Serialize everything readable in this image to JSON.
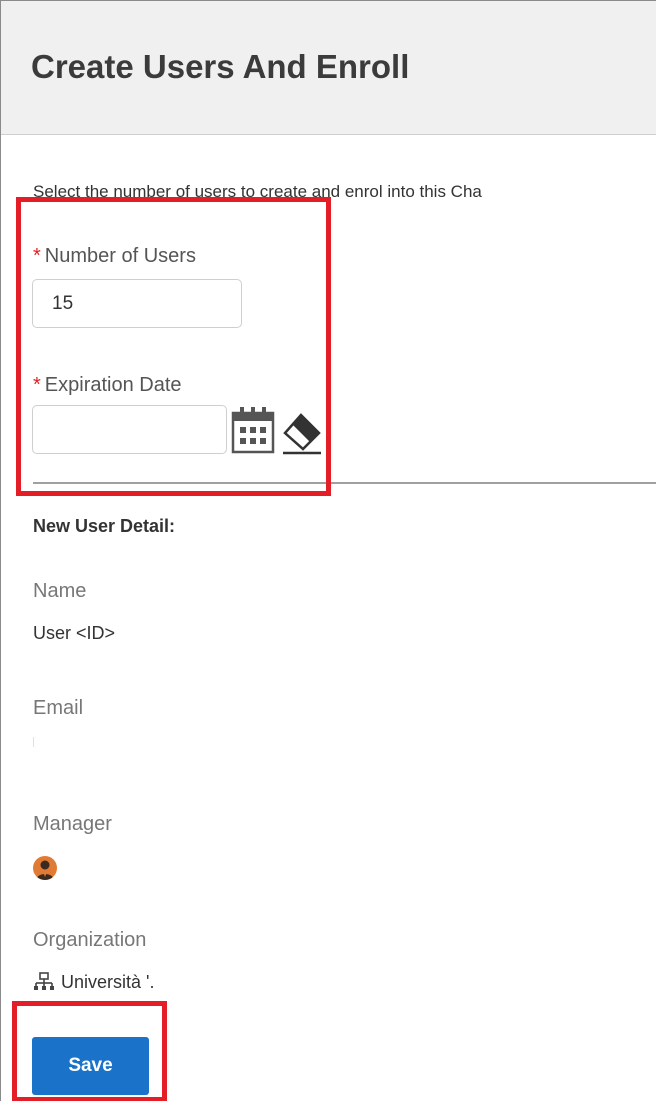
{
  "header": {
    "title": "Create Users And Enroll"
  },
  "instruction": "Select the number of users to create and enrol into this Cha",
  "form": {
    "number_of_users": {
      "required_mark": "*",
      "label": "Number of Users",
      "value": "15"
    },
    "expiration_date": {
      "required_mark": "*",
      "label": "Expiration Date",
      "value": "",
      "calendar_icon": "calendar-icon",
      "clear_icon": "eraser-icon"
    }
  },
  "new_user_detail": {
    "heading": "New User Detail:",
    "name_label": "Name",
    "name_value": "User <ID>",
    "email_label": "Email",
    "email_value": "",
    "manager_label": "Manager",
    "manager_icon": "user-avatar-icon",
    "organization_label": "Organization",
    "organization_icon": "org-chart-icon",
    "organization_value": "Università '."
  },
  "actions": {
    "save_label": "Save"
  },
  "colors": {
    "header_bg": "#f0f0f0",
    "required": "#e02020",
    "primary_button": "#1a73c9",
    "highlight": "#e41e26",
    "avatar": "#e07a35"
  }
}
